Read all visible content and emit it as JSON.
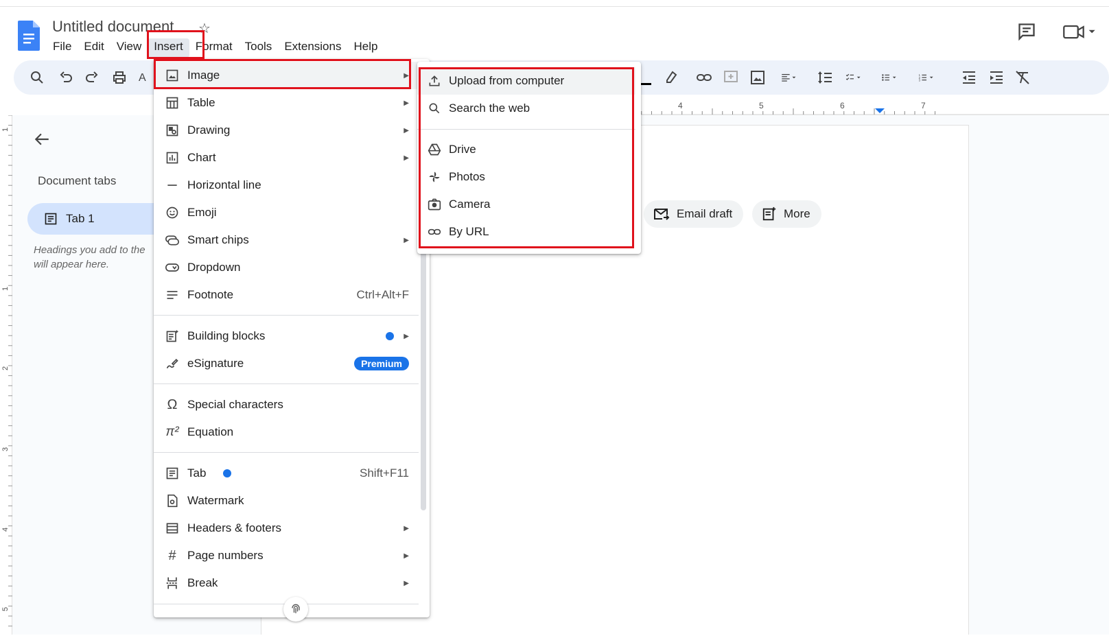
{
  "header": {
    "title": "Untitled document",
    "menus": [
      "File",
      "Edit",
      "View",
      "Insert",
      "Format",
      "Tools",
      "Extensions",
      "Help"
    ],
    "active_menu": "Insert"
  },
  "ruler": {
    "labels": [
      "4",
      "5",
      "6",
      "7"
    ]
  },
  "vruler": {
    "labels": [
      "1",
      "1",
      "2",
      "3",
      "4",
      "5"
    ]
  },
  "sidebar": {
    "title": "Document tabs",
    "tab_label": "Tab 1",
    "hint": "Headings you add to the\nwill appear here."
  },
  "chips": {
    "email": "Email draft",
    "more": "More"
  },
  "insert_menu": {
    "items": [
      {
        "label": "Image",
        "icon": "image-icon",
        "submenu": true
      },
      {
        "label": "Table",
        "icon": "table-icon",
        "submenu": true
      },
      {
        "label": "Drawing",
        "icon": "drawing-icon",
        "submenu": true
      },
      {
        "label": "Chart",
        "icon": "chart-icon",
        "submenu": true
      },
      {
        "label": "Horizontal line",
        "icon": "horizontal-line-icon",
        "submenu": false
      },
      {
        "label": "Emoji",
        "icon": "emoji-icon",
        "submenu": false
      },
      {
        "label": "Smart chips",
        "icon": "smart-chips-icon",
        "submenu": true
      },
      {
        "label": "Dropdown",
        "icon": "dropdown-icon",
        "submenu": false
      },
      {
        "label": "Footnote",
        "icon": "footnote-icon",
        "shortcut": "Ctrl+Alt+F"
      },
      {
        "label": "Building blocks",
        "icon": "building-blocks-icon",
        "submenu": true,
        "new_dot": true
      },
      {
        "label": "eSignature",
        "icon": "esignature-icon",
        "badge": "Premium"
      },
      {
        "label": "Special characters",
        "icon": "omega-icon"
      },
      {
        "label": "Equation",
        "icon": "pi-icon"
      },
      {
        "label": "Tab",
        "icon": "tab-icon",
        "shortcut": "Shift+F11",
        "new_dot": true
      },
      {
        "label": "Watermark",
        "icon": "watermark-icon"
      },
      {
        "label": "Headers & footers",
        "icon": "headers-footers-icon",
        "submenu": true
      },
      {
        "label": "Page numbers",
        "icon": "hash-icon",
        "submenu": true
      },
      {
        "label": "Break",
        "icon": "break-icon",
        "submenu": true
      }
    ]
  },
  "image_submenu": {
    "items": [
      {
        "label": "Upload from computer",
        "icon": "upload-icon"
      },
      {
        "label": "Search the web",
        "icon": "search-icon"
      },
      {
        "label": "Drive",
        "icon": "drive-icon"
      },
      {
        "label": "Photos",
        "icon": "photos-icon"
      },
      {
        "label": "Camera",
        "icon": "camera-icon"
      },
      {
        "label": "By URL",
        "icon": "link-icon"
      }
    ]
  },
  "colors": {
    "accent": "#1a73e8",
    "highlight_box": "#e0121c",
    "toolbar_bg": "#edf2fa",
    "tab_selected": "#d3e3fd"
  }
}
